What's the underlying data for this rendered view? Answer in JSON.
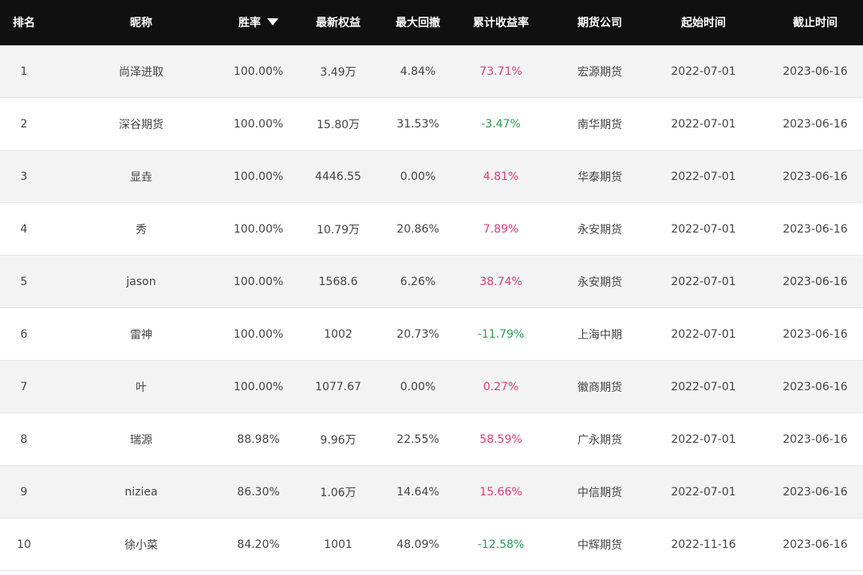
{
  "colors": {
    "header_bg": "#101010",
    "row_stripe": "#f3f3f3",
    "positive": "#e23b74",
    "negative": "#2a9d52"
  },
  "table": {
    "headers": {
      "rank": "排名",
      "nickname": "昵称",
      "win_rate": "胜率",
      "equity": "最新权益",
      "max_drawdown": "最大回撤",
      "cumulative_return": "累计收益率",
      "broker": "期货公司",
      "start": "起始时间",
      "end": "截止时间"
    },
    "sort_icon": "caret-down-icon",
    "rows": [
      {
        "rank": "1",
        "nickname": "尚泽进取",
        "win_rate": "100.00%",
        "equity": "3.49万",
        "max_drawdown": "4.84%",
        "cumulative_return": "73.71%",
        "return_sign": "pos",
        "broker": "宏源期货",
        "start": "2022-07-01",
        "end": "2023-06-16"
      },
      {
        "rank": "2",
        "nickname": "深谷期货",
        "win_rate": "100.00%",
        "equity": "15.80万",
        "max_drawdown": "31.53%",
        "cumulative_return": "-3.47%",
        "return_sign": "neg",
        "broker": "南华期货",
        "start": "2022-07-01",
        "end": "2023-06-16"
      },
      {
        "rank": "3",
        "nickname": "显垚",
        "win_rate": "100.00%",
        "equity": "4446.55",
        "max_drawdown": "0.00%",
        "cumulative_return": "4.81%",
        "return_sign": "pos",
        "broker": "华泰期货",
        "start": "2022-07-01",
        "end": "2023-06-16"
      },
      {
        "rank": "4",
        "nickname": "秀",
        "win_rate": "100.00%",
        "equity": "10.79万",
        "max_drawdown": "20.86%",
        "cumulative_return": "7.89%",
        "return_sign": "pos",
        "broker": "永安期货",
        "start": "2022-07-01",
        "end": "2023-06-16"
      },
      {
        "rank": "5",
        "nickname": "jason",
        "win_rate": "100.00%",
        "equity": "1568.6",
        "max_drawdown": "6.26%",
        "cumulative_return": "38.74%",
        "return_sign": "pos",
        "broker": "永安期货",
        "start": "2022-07-01",
        "end": "2023-06-16"
      },
      {
        "rank": "6",
        "nickname": "雷神",
        "win_rate": "100.00%",
        "equity": "1002",
        "max_drawdown": "20.73%",
        "cumulative_return": "-11.79%",
        "return_sign": "neg",
        "broker": "上海中期",
        "start": "2022-07-01",
        "end": "2023-06-16"
      },
      {
        "rank": "7",
        "nickname": "叶",
        "win_rate": "100.00%",
        "equity": "1077.67",
        "max_drawdown": "0.00%",
        "cumulative_return": "0.27%",
        "return_sign": "pos",
        "broker": "徽商期货",
        "start": "2022-07-01",
        "end": "2023-06-16"
      },
      {
        "rank": "8",
        "nickname": "瑞源",
        "win_rate": "88.98%",
        "equity": "9.96万",
        "max_drawdown": "22.55%",
        "cumulative_return": "58.59%",
        "return_sign": "pos",
        "broker": "广永期货",
        "start": "2022-07-01",
        "end": "2023-06-16"
      },
      {
        "rank": "9",
        "nickname": "niziea",
        "win_rate": "86.30%",
        "equity": "1.06万",
        "max_drawdown": "14.64%",
        "cumulative_return": "15.66%",
        "return_sign": "pos",
        "broker": "中信期货",
        "start": "2022-07-01",
        "end": "2023-06-16"
      },
      {
        "rank": "10",
        "nickname": "徐小菜",
        "win_rate": "84.20%",
        "equity": "1001",
        "max_drawdown": "48.09%",
        "cumulative_return": "-12.58%",
        "return_sign": "neg",
        "broker": "中辉期货",
        "start": "2022-11-16",
        "end": "2023-06-16"
      }
    ]
  }
}
